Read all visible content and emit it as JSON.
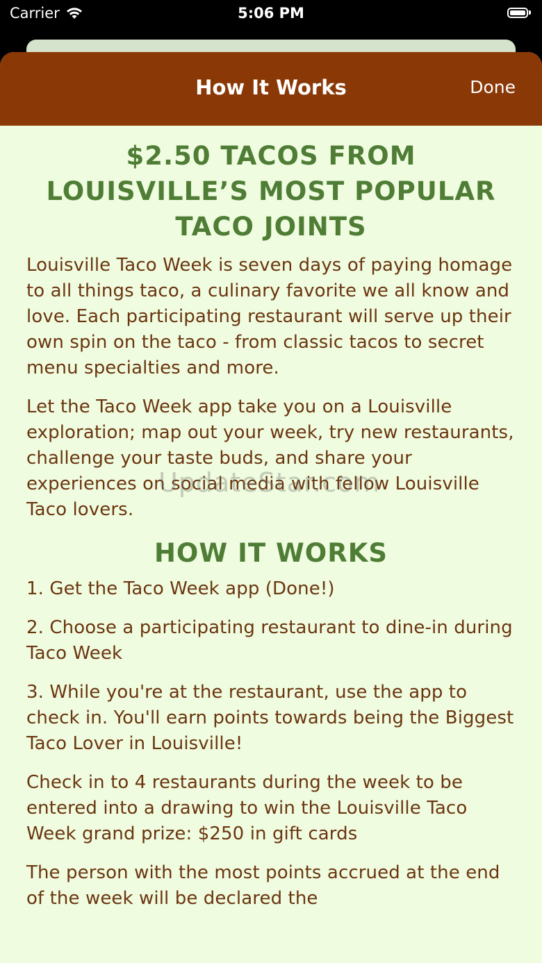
{
  "status_bar": {
    "carrier": "Carrier",
    "time": "5:06 PM"
  },
  "nav": {
    "title": "How It Works",
    "done_label": "Done"
  },
  "colors": {
    "nav_background": "#8a3806",
    "sheet_background": "#effcdf",
    "heading_green": "#4f7d36",
    "body_brown": "#6b3510"
  },
  "content": {
    "main_heading": "$2.50 TACOS FROM LOUISVILLE’S MOST POPULAR TACO JOINTS",
    "intro_paragraphs": [
      "Louisville Taco Week is seven days of paying homage to all things taco, a culinary favorite we all know and love. Each participating restaurant will serve up their own spin on the taco - from classic tacos to secret menu specialties and more.",
      "Let the Taco Week app take you on a Louisville exploration; map out your week, try new restaurants, challenge your taste buds, and share your experiences on social media with fellow Louisville Taco lovers."
    ],
    "how_heading": "HOW IT WORKS",
    "steps": [
      "1. Get the Taco Week app (Done!)",
      "2. Choose a participating restaurant to dine-in during Taco Week",
      "3. While you're at the restaurant, use the app to check in. You'll earn points towards being the Biggest Taco Lover in Louisville!",
      "Check in to 4 restaurants during the week to be entered into a drawing to win the Louisville Taco Week grand prize: $250 in gift cards",
      "The person with the most points accrued at the end of the week will be declared the"
    ]
  },
  "watermark": "UpdateStar.com"
}
